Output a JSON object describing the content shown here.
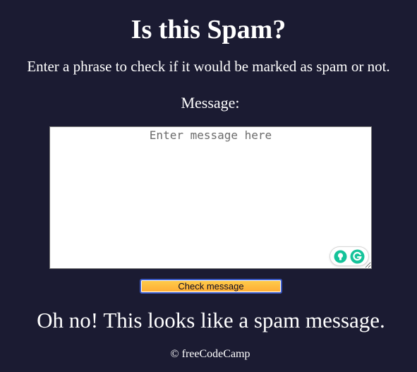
{
  "header": {
    "title": "Is this Spam?",
    "description": "Enter a phrase to check if it would be marked as spam or not."
  },
  "form": {
    "label": "Message:",
    "message_value": "",
    "message_placeholder": "Enter message here",
    "submit_label": "Check message"
  },
  "grammarly": {
    "suggestion_icon": "lightbulb-icon",
    "logo_icon": "grammarly-g-icon",
    "accent_color": "#15c39a"
  },
  "result": {
    "text": "Oh no! This looks like a spam message."
  },
  "footer": {
    "text": "© freeCodeCamp"
  },
  "colors": {
    "background": "#1b1b32",
    "button_fill": "#fecc4c",
    "button_border": "#3b59c4"
  }
}
